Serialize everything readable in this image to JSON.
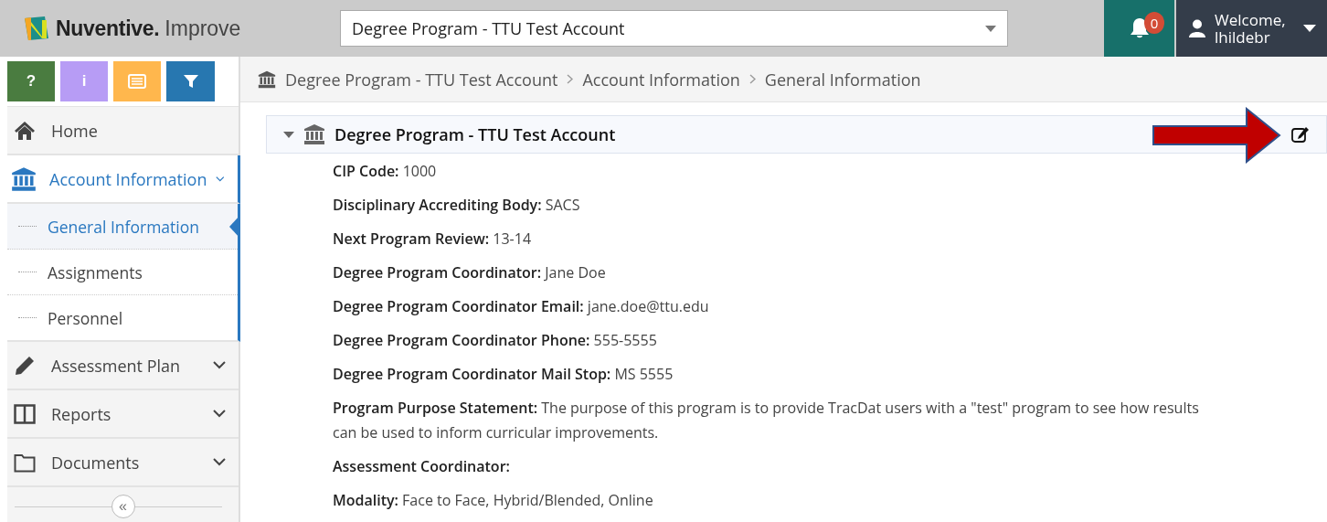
{
  "header": {
    "logo_brand": "Nuventive.",
    "logo_product": "Improve",
    "account_select": {
      "value": "Degree Program - TTU Test Account"
    },
    "notifications": {
      "count": "0"
    },
    "user": {
      "greeting": "Welcome,",
      "name": "lhildebr"
    }
  },
  "toolbar": [
    {
      "label": "?",
      "color": "#4a7c40"
    },
    {
      "label": "i",
      "color": "#b79cf5"
    },
    {
      "color": "#ffb74d"
    },
    {
      "color": "#2777b0"
    }
  ],
  "sidebar": {
    "items": [
      {
        "label": "Home",
        "kind": "link",
        "selected": false
      },
      {
        "label": "Account Information",
        "kind": "group",
        "expanded": true,
        "selected": true,
        "children": [
          {
            "label": "General Information",
            "selected": true
          },
          {
            "label": "Assignments",
            "selected": false
          },
          {
            "label": "Personnel",
            "selected": false
          }
        ]
      },
      {
        "label": "Assessment Plan",
        "kind": "group",
        "expanded": false,
        "selected": false
      },
      {
        "label": "Reports",
        "kind": "group",
        "expanded": false,
        "selected": false
      },
      {
        "label": "Documents",
        "kind": "group",
        "expanded": false,
        "selected": false
      }
    ],
    "collapse": "«"
  },
  "breadcrumb": [
    "Degree Program - TTU Test Account",
    "Account Information",
    "General Information"
  ],
  "panel": {
    "title": "Degree Program - TTU Test Account",
    "expanded": true,
    "fields": [
      {
        "label": "CIP Code:",
        "value": "1000"
      },
      {
        "label": "Disciplinary Accrediting Body:",
        "value": "SACS"
      },
      {
        "label": "Next Program Review:",
        "value": "13-14"
      },
      {
        "label": "Degree Program Coordinator:",
        "value": "Jane Doe"
      },
      {
        "label": "Degree Program Coordinator Email:",
        "value": "jane.doe@ttu.edu"
      },
      {
        "label": "Degree Program Coordinator Phone:",
        "value": "555-5555"
      },
      {
        "label": "Degree Program Coordinator Mail Stop:",
        "value": "MS 5555"
      },
      {
        "label": "Program Purpose Statement:",
        "value": "The purpose of this program is to provide TracDat users with a \"test\" program to see how results can be used to inform curricular improvements."
      },
      {
        "label": "Assessment Coordinator:"
      },
      {
        "label": "Modality:",
        "value": "Face to Face, Hybrid/Blended, Online"
      }
    ]
  }
}
